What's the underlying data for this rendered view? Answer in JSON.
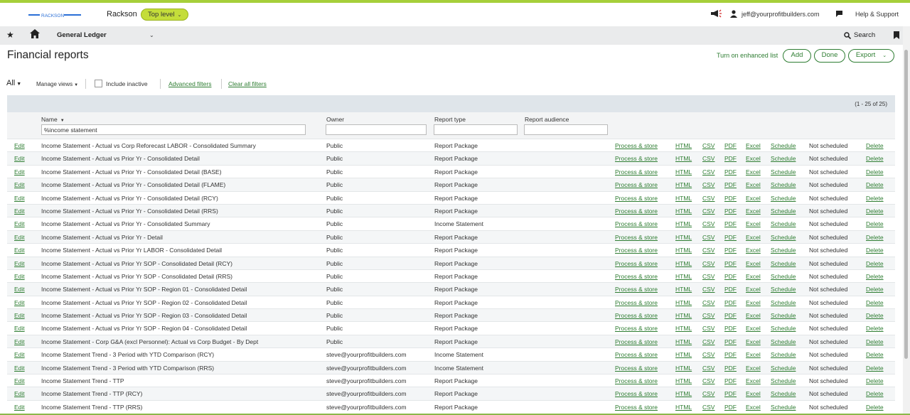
{
  "brand": {
    "logo_text": "RACKSON",
    "app_name": "Rackson",
    "level": "Top level",
    "accent": "#c4dd3a",
    "link_color": "#2e7d32"
  },
  "header": {
    "user_email": "jeff@yourprofitbuilders.com",
    "help": "Help & Support"
  },
  "nav": {
    "title": "General Ledger",
    "search": "Search"
  },
  "page": {
    "title": "Financial reports",
    "enhanced_list": "Turn on enhanced list",
    "add": "Add",
    "done": "Done",
    "export": "Export"
  },
  "filters": {
    "all": "All",
    "manage_views": "Manage views",
    "include_inactive": "Include inactive",
    "advanced": "Advanced filters",
    "clear": "Clear all filters"
  },
  "table": {
    "count": "(1 - 25 of 25)",
    "columns": {
      "name": "Name",
      "owner": "Owner",
      "type": "Report type",
      "audience": "Report audience"
    },
    "name_filter": "%income statement",
    "row_actions": {
      "edit": "Edit",
      "process": "Process & store",
      "html": "HTML",
      "csv": "CSV",
      "pdf": "PDF",
      "excel": "Excel",
      "schedule": "Schedule",
      "status": "Not scheduled",
      "delete": "Delete"
    },
    "rows": [
      {
        "name": "Income Statement - Actual vs Corp Reforecast LABOR - Consolidated Summary",
        "owner": "Public",
        "type": "Report Package"
      },
      {
        "name": "Income Statement - Actual vs Prior Yr - Consolidated Detail",
        "owner": "Public",
        "type": "Report Package"
      },
      {
        "name": "Income Statement - Actual vs Prior Yr - Consolidated Detail (BASE)",
        "owner": "Public",
        "type": "Report Package"
      },
      {
        "name": "Income Statement - Actual vs Prior Yr - Consolidated Detail (FLAME)",
        "owner": "Public",
        "type": "Report Package"
      },
      {
        "name": "Income Statement - Actual vs Prior Yr - Consolidated Detail (RCY)",
        "owner": "Public",
        "type": "Report Package"
      },
      {
        "name": "Income Statement - Actual vs Prior Yr - Consolidated Detail (RRS)",
        "owner": "Public",
        "type": "Report Package"
      },
      {
        "name": "Income Statement - Actual vs Prior Yr - Consolidated Summary",
        "owner": "Public",
        "type": "Income Statement"
      },
      {
        "name": "Income Statement - Actual vs Prior Yr - Detail",
        "owner": "Public",
        "type": "Report Package"
      },
      {
        "name": "Income Statement - Actual vs Prior Yr LABOR - Consolidated Detail",
        "owner": "Public",
        "type": "Report Package"
      },
      {
        "name": "Income Statement - Actual vs Prior Yr SOP - Consolidated Detail (RCY)",
        "owner": "Public",
        "type": "Report Package"
      },
      {
        "name": "Income Statement - Actual vs Prior Yr SOP - Consolidated Detail (RRS)",
        "owner": "Public",
        "type": "Report Package"
      },
      {
        "name": "Income Statement - Actual vs Prior Yr SOP - Region 01 - Consolidated Detail",
        "owner": "Public",
        "type": "Report Package"
      },
      {
        "name": "Income Statement - Actual vs Prior Yr SOP - Region 02 - Consolidated Detail",
        "owner": "Public",
        "type": "Report Package"
      },
      {
        "name": "Income Statement - Actual vs Prior Yr SOP - Region 03 - Consolidated Detail",
        "owner": "Public",
        "type": "Report Package"
      },
      {
        "name": "Income Statement - Actual vs Prior Yr SOP - Region 04 - Consolidated Detail",
        "owner": "Public",
        "type": "Report Package"
      },
      {
        "name": "Income Statement - Corp G&A (excl Personnel): Actual vs Corp Budget - By Dept",
        "owner": "Public",
        "type": "Report Package"
      },
      {
        "name": "Income Statement Trend - 3 Period with YTD Comparison (RCY)",
        "owner": "steve@yourprofitbuilders.com",
        "type": "Income Statement"
      },
      {
        "name": "Income Statement Trend - 3 Period with YTD Comparison (RRS)",
        "owner": "steve@yourprofitbuilders.com",
        "type": "Income Statement"
      },
      {
        "name": "Income Statement Trend - TTP",
        "owner": "steve@yourprofitbuilders.com",
        "type": "Report Package"
      },
      {
        "name": "Income Statement Trend - TTP (RCY)",
        "owner": "steve@yourprofitbuilders.com",
        "type": "Report Package"
      },
      {
        "name": "Income Statement Trend - TTP (RRS)",
        "owner": "steve@yourprofitbuilders.com",
        "type": "Report Package"
      }
    ]
  }
}
